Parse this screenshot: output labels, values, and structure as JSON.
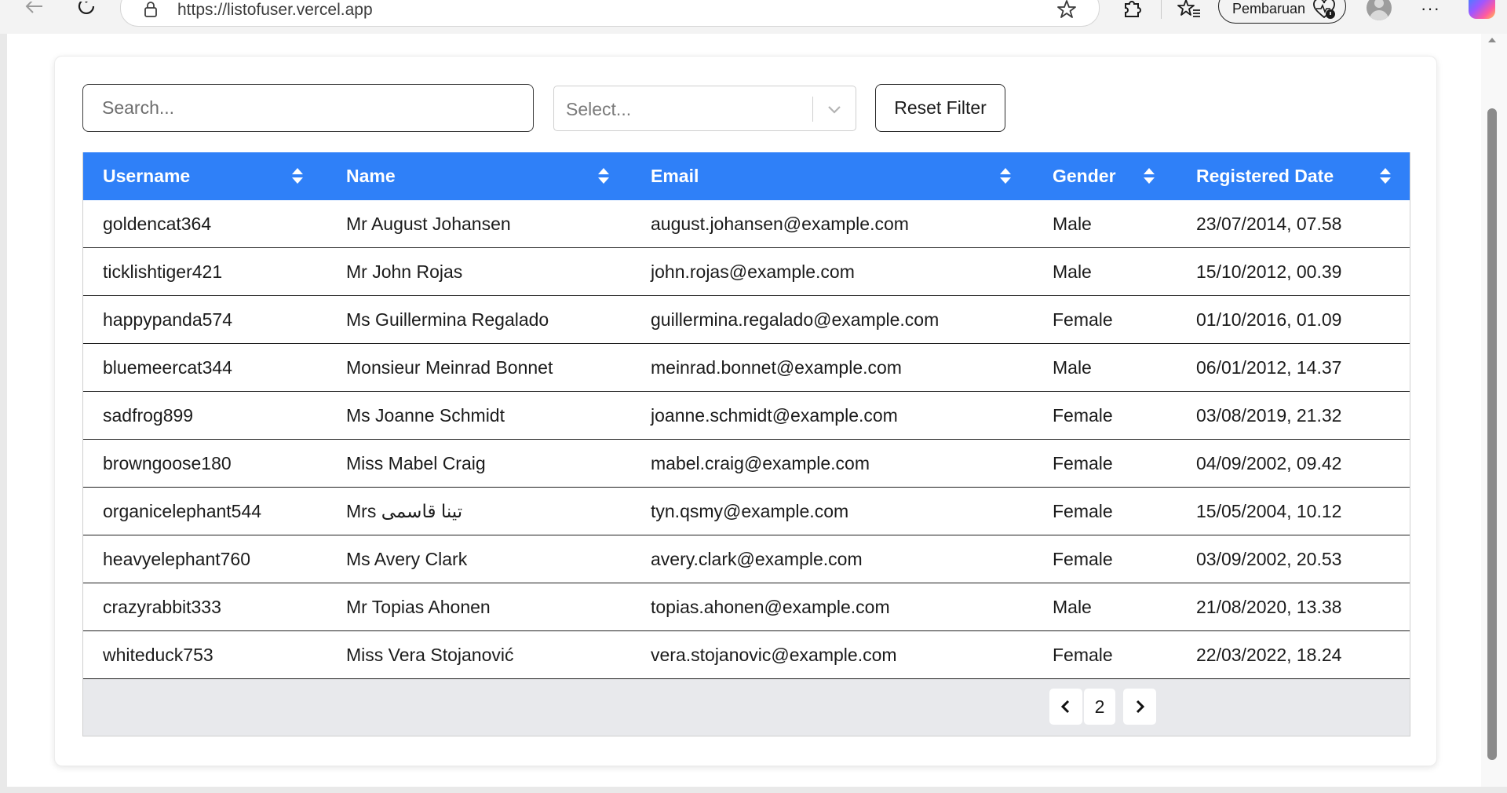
{
  "browser": {
    "url": "https://listofuser.vercel.app",
    "update_label": "Pembaruan",
    "more_label": "···"
  },
  "filters": {
    "search_placeholder": "Search...",
    "select_placeholder": "Select...",
    "reset_label": "Reset Filter"
  },
  "table": {
    "columns": [
      "Username",
      "Name",
      "Email",
      "Gender",
      "Registered Date"
    ],
    "rows": [
      {
        "username": "goldencat364",
        "name": "Mr August Johansen",
        "email": "august.johansen@example.com",
        "gender": "Male",
        "registered": "23/07/2014, 07.58"
      },
      {
        "username": "ticklishtiger421",
        "name": "Mr John Rojas",
        "email": "john.rojas@example.com",
        "gender": "Male",
        "registered": "15/10/2012, 00.39"
      },
      {
        "username": "happypanda574",
        "name": "Ms Guillermina Regalado",
        "email": "guillermina.regalado@example.com",
        "gender": "Female",
        "registered": "01/10/2016, 01.09"
      },
      {
        "username": "bluemeercat344",
        "name": "Monsieur Meinrad Bonnet",
        "email": "meinrad.bonnet@example.com",
        "gender": "Male",
        "registered": "06/01/2012, 14.37"
      },
      {
        "username": "sadfrog899",
        "name": "Ms Joanne Schmidt",
        "email": "joanne.schmidt@example.com",
        "gender": "Female",
        "registered": "03/08/2019, 21.32"
      },
      {
        "username": "browngoose180",
        "name": "Miss Mabel Craig",
        "email": "mabel.craig@example.com",
        "gender": "Female",
        "registered": "04/09/2002, 09.42"
      },
      {
        "username": "organicelephant544",
        "name": "Mrs تينا قاسمی",
        "email": "tyn.qsmy@example.com",
        "gender": "Female",
        "registered": "15/05/2004, 10.12"
      },
      {
        "username": "heavyelephant760",
        "name": "Ms Avery Clark",
        "email": "avery.clark@example.com",
        "gender": "Female",
        "registered": "03/09/2002, 20.53"
      },
      {
        "username": "crazyrabbit333",
        "name": "Mr Topias Ahonen",
        "email": "topias.ahonen@example.com",
        "gender": "Male",
        "registered": "21/08/2020, 13.38"
      },
      {
        "username": "whiteduck753",
        "name": "Miss Vera Stojanović",
        "email": "vera.stojanovic@example.com",
        "gender": "Female",
        "registered": "22/03/2022, 18.24"
      }
    ]
  },
  "pagination": {
    "current_page": "2"
  },
  "colors": {
    "header_bg": "#2f80f8",
    "footer_bg": "#e8e9ec"
  },
  "icons": [
    "back-icon",
    "refresh-icon",
    "lock-icon",
    "favorite-star-icon",
    "extensions-icon",
    "favorites-icon",
    "heart-pulse-icon",
    "profile-avatar",
    "copilot-icon",
    "sort-icon",
    "chevron-down-icon",
    "chevron-left-icon",
    "chevron-right-icon"
  ]
}
